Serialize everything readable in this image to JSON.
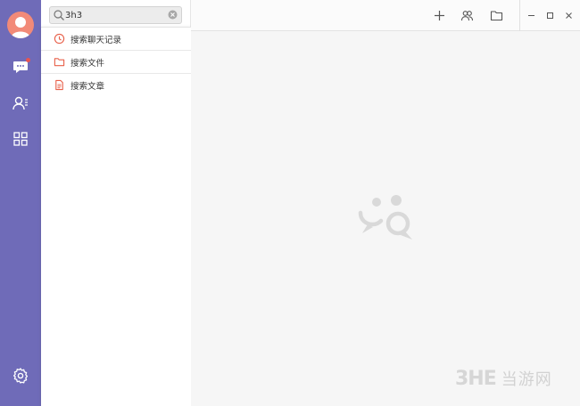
{
  "sidebar": {
    "items": [
      {
        "name": "chat",
        "icon": "chat-bubble-icon",
        "has_badge": true
      },
      {
        "name": "contacts",
        "icon": "contacts-icon"
      },
      {
        "name": "apps",
        "icon": "apps-grid-icon"
      }
    ],
    "settings_icon": "gear-icon",
    "color": "#6f6bb8",
    "badge_color": "#e8544f",
    "avatar_color": "#f28a78"
  },
  "search": {
    "value": "3h3"
  },
  "dropdown": {
    "items": [
      {
        "label": "搜索聊天记录",
        "icon": "clock-icon"
      },
      {
        "label": "搜索文件",
        "icon": "folder-icon"
      },
      {
        "label": "搜索文章",
        "icon": "document-icon"
      }
    ],
    "icon_color": "#e8604a"
  },
  "topbar": {
    "actions": [
      "add-icon",
      "group-icon",
      "folder-icon"
    ],
    "window_controls": [
      "minimize-icon",
      "maximize-icon",
      "close-icon"
    ]
  },
  "watermark": {
    "mark": "3HE",
    "text": "当游网"
  }
}
